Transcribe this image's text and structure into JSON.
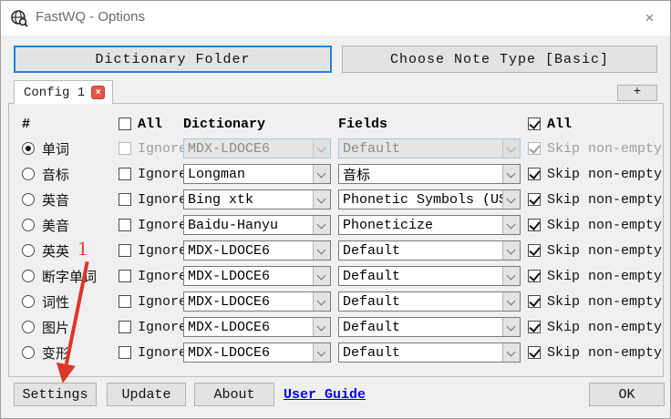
{
  "window": {
    "title": "FastWQ - Options",
    "close_glyph": "×"
  },
  "toolbar": {
    "dictionary_folder_label": "Dictionary Folder",
    "choose_note_type_label": "Choose Note Type [Basic]"
  },
  "tabs": {
    "active_label": "Config 1",
    "close_glyph": "×",
    "add_label": "+"
  },
  "table": {
    "headers": {
      "hash": "#",
      "all_left": "All",
      "dictionary": "Dictionary",
      "fields": "Fields",
      "all_right": "All"
    },
    "all_left_checked": false,
    "all_right_checked": true,
    "ignore_label": "Ignore",
    "skip_label": "Skip non-empty",
    "rows": [
      {
        "name": "单词",
        "selected": true,
        "disabled": true,
        "ignore_checked": false,
        "dictionary": "MDX-LDOCE6",
        "field": "Default",
        "skip_checked": true
      },
      {
        "name": "音标",
        "selected": false,
        "disabled": false,
        "ignore_checked": false,
        "dictionary": "Longman",
        "field": "音标",
        "skip_checked": true
      },
      {
        "name": "英音",
        "selected": false,
        "disabled": false,
        "ignore_checked": false,
        "dictionary": "Bing xtk",
        "field": "Phonetic Symbols (US)",
        "skip_checked": true
      },
      {
        "name": "美音",
        "selected": false,
        "disabled": false,
        "ignore_checked": false,
        "dictionary": "Baidu-Hanyu",
        "field": "Phoneticize",
        "skip_checked": true
      },
      {
        "name": "英英",
        "selected": false,
        "disabled": false,
        "ignore_checked": false,
        "dictionary": "MDX-LDOCE6",
        "field": "Default",
        "skip_checked": true
      },
      {
        "name": "断字单词",
        "selected": false,
        "disabled": false,
        "ignore_checked": false,
        "dictionary": "MDX-LDOCE6",
        "field": "Default",
        "skip_checked": true
      },
      {
        "name": "词性",
        "selected": false,
        "disabled": false,
        "ignore_checked": false,
        "dictionary": "MDX-LDOCE6",
        "field": "Default",
        "skip_checked": true
      },
      {
        "name": "图片",
        "selected": false,
        "disabled": false,
        "ignore_checked": false,
        "dictionary": "MDX-LDOCE6",
        "field": "Default",
        "skip_checked": true
      },
      {
        "name": "变形",
        "selected": false,
        "disabled": false,
        "ignore_checked": false,
        "dictionary": "MDX-LDOCE6",
        "field": "Default",
        "skip_checked": true
      }
    ]
  },
  "footer": {
    "settings_label": "Settings",
    "update_label": "Update",
    "about_label": "About",
    "user_guide_label": "User Guide",
    "ok_label": "OK"
  },
  "annotation": {
    "number": "1",
    "color": "#e0352b"
  },
  "colors": {
    "focus_border": "#1d83d8",
    "link": "#0000ee",
    "tab_close_bg": "#e2594b",
    "annotation_red": "#e0352b",
    "dialog_bg": "#f0f0f0",
    "titlebar_bg": "#ffffff"
  }
}
